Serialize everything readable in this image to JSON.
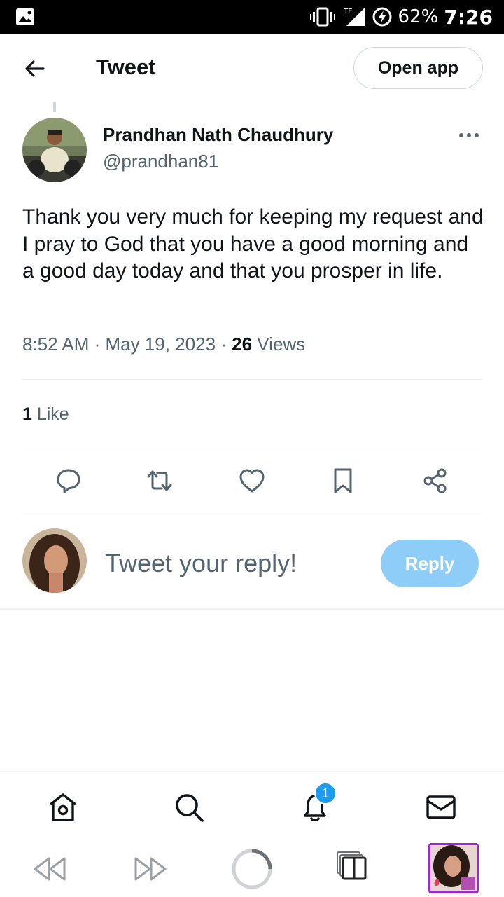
{
  "status_bar": {
    "network": "LTE",
    "battery": "62%",
    "time": "7:26",
    "icons": [
      "image-icon",
      "vibrate-icon",
      "signal-icon",
      "battery-saver-icon"
    ]
  },
  "header": {
    "title": "Tweet",
    "open_app_label": "Open app"
  },
  "tweet": {
    "author_name": "Prandhan Nath Chaudhury",
    "author_handle": "@prandhan81",
    "text": "Thank you very much for keeping my request and I pray to God that you have a good morning and a good day today and that you prosper in life.",
    "timestamp": "8:52 AM · May 19, 2023 · ",
    "views_count": "26",
    "views_label": " Views",
    "likes_count": "1",
    "likes_label": " Like"
  },
  "actions": [
    "reply-icon",
    "retweet-icon",
    "like-icon",
    "bookmark-icon",
    "share-icon"
  ],
  "reply": {
    "placeholder": "Tweet your reply!",
    "button_label": "Reply"
  },
  "tabbar": {
    "tabs": [
      "home-icon",
      "search-icon",
      "notifications-icon",
      "messages-icon"
    ],
    "notification_badge": "1"
  },
  "browser_nav": [
    "back-icon",
    "forward-icon",
    "loading-icon",
    "tabs-icon",
    "profile-thumbnail"
  ],
  "colors": {
    "accent": "#1d9bf0",
    "reply_button_disabled": "#8ecdf8",
    "secondary_text": "#536471",
    "primary_text": "#0f1419"
  }
}
